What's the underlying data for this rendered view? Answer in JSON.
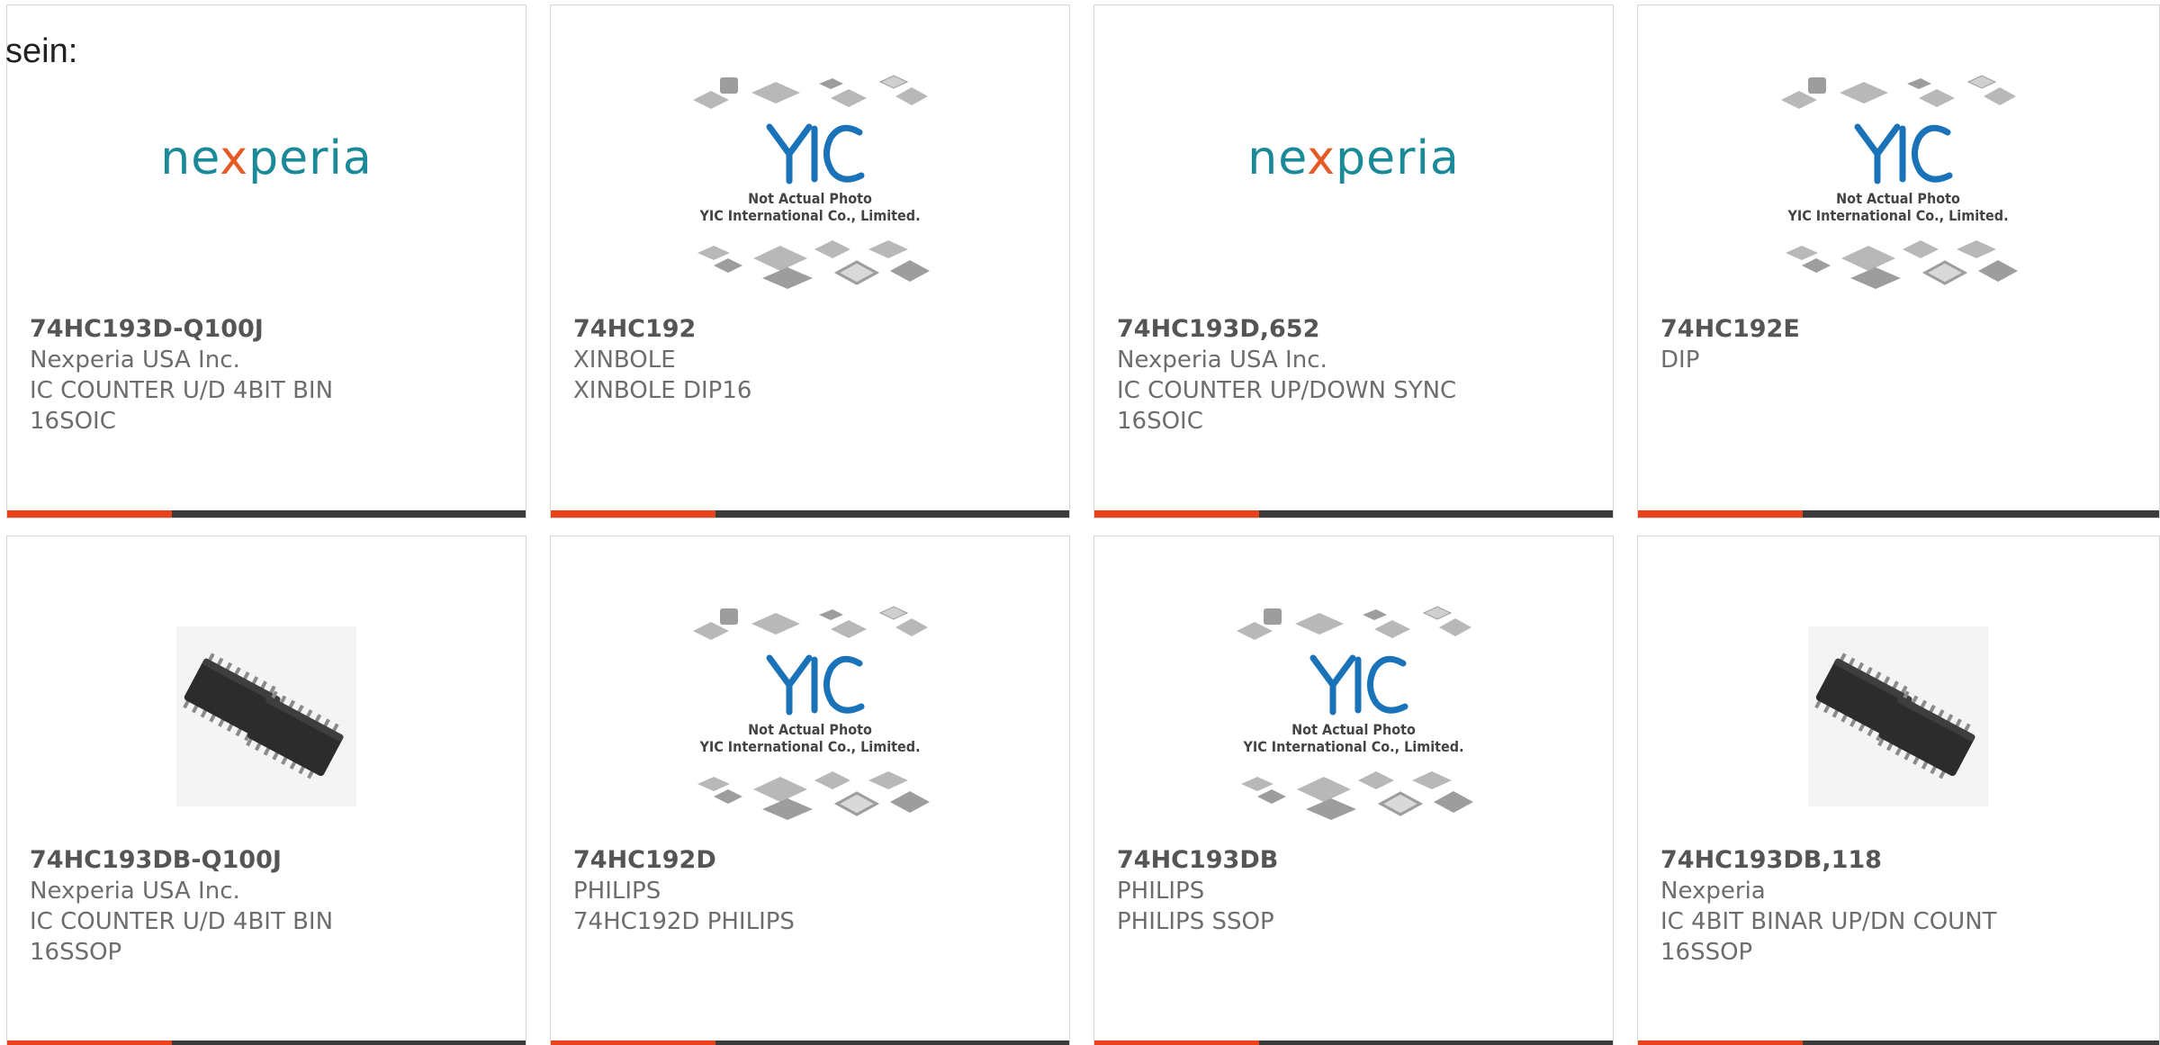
{
  "top_label": "sein:",
  "colors": {
    "accent": "#e8431a",
    "bar": "#3b3b3b",
    "nexperia_teal": "#1a8a99",
    "nexperia_orange": "#e55a25"
  },
  "placeholder": {
    "line1": "Not Actual Photo",
    "line2": "YIC International Co., Limited."
  },
  "cards": [
    {
      "image": "nexperia-logo",
      "logo_parts": [
        "ne",
        "x",
        "peria"
      ],
      "part": "74HC193D-Q100J",
      "lines": [
        "Nexperia USA Inc.",
        "IC COUNTER U/D 4BIT BIN",
        "16SOIC"
      ]
    },
    {
      "image": "yic-placeholder",
      "part": "74HC192",
      "lines": [
        "XINBOLE",
        "XINBOLE DIP16",
        ""
      ]
    },
    {
      "image": "nexperia-logo",
      "logo_parts": [
        "ne",
        "x",
        "peria"
      ],
      "part": "74HC193D,652",
      "lines": [
        "Nexperia USA Inc.",
        "IC COUNTER UP/DOWN SYNC",
        "16SOIC"
      ]
    },
    {
      "image": "yic-placeholder",
      "part": "74HC192E",
      "lines": [
        "DIP",
        "",
        ""
      ]
    },
    {
      "image": "ssop-chip-photo",
      "part": "74HC193DB-Q100J",
      "lines": [
        "Nexperia USA Inc.",
        "IC COUNTER U/D 4BIT BIN",
        "16SSOP"
      ]
    },
    {
      "image": "yic-placeholder",
      "part": "74HC192D",
      "lines": [
        "PHILIPS",
        "74HC192D PHILIPS",
        ""
      ]
    },
    {
      "image": "yic-placeholder",
      "part": "74HC193DB",
      "lines": [
        "PHILIPS",
        "PHILIPS SSOP",
        ""
      ]
    },
    {
      "image": "ssop-chip-photo",
      "part": "74HC193DB,118",
      "lines": [
        "Nexperia",
        "IC 4BIT BINAR UP/DN COUNT",
        "16SSOP"
      ]
    }
  ]
}
